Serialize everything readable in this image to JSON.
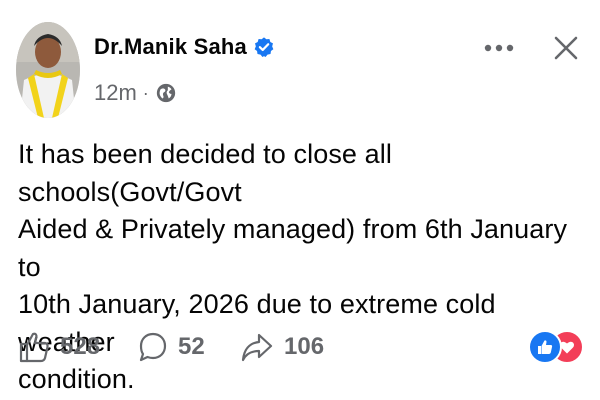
{
  "author": {
    "name": "Dr.Manik Saha",
    "verified": true
  },
  "meta": {
    "timestamp": "12m",
    "separator": "·",
    "audience_icon": "globe-icon"
  },
  "header_actions": {
    "more_icon": "more-dots-icon",
    "close_icon": "close-icon"
  },
  "post": {
    "text": "It has been decided to close all schools(Govt/Govt\nAided & Privately managed) from 6th January to\n10th January, 2026 due to extreme cold weather\ncondition."
  },
  "actions": {
    "likes": "528",
    "comments": "52",
    "shares": "106"
  },
  "reactions": [
    "like",
    "love"
  ],
  "colors": {
    "verified_badge": "#1877f2",
    "like_reaction": "#1877f2",
    "love_reaction": "#f33e58",
    "secondary_text": "#65676b"
  }
}
